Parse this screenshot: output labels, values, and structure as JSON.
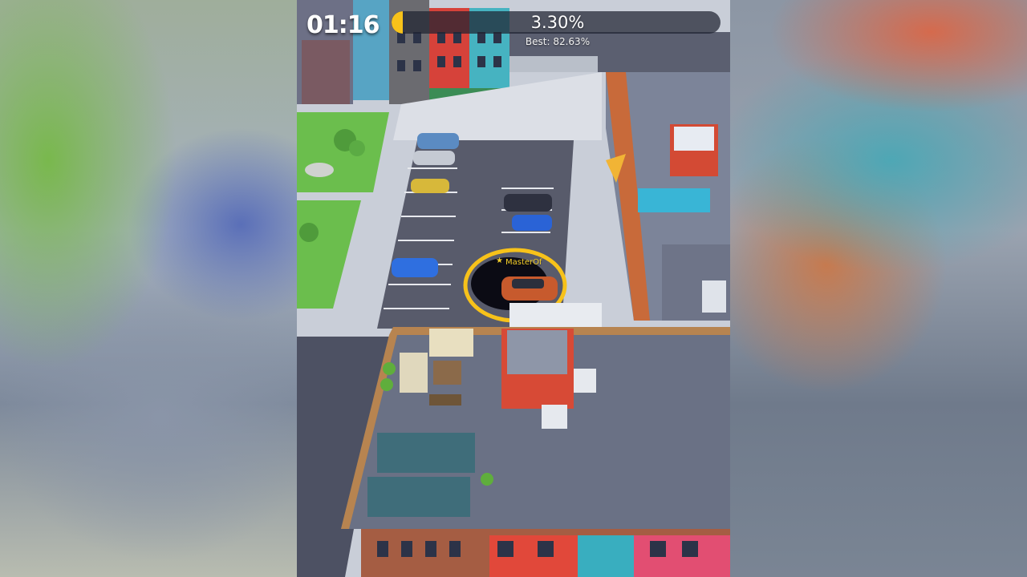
{
  "hud": {
    "timer": "01:16",
    "progress_text": "3.30%",
    "progress_fraction": 0.033,
    "best_text": "Best: 82.63%"
  },
  "player": {
    "name": "MasterOf",
    "star": "★"
  },
  "colors": {
    "accent": "#f7c21a",
    "hole": "#0b0b14"
  }
}
